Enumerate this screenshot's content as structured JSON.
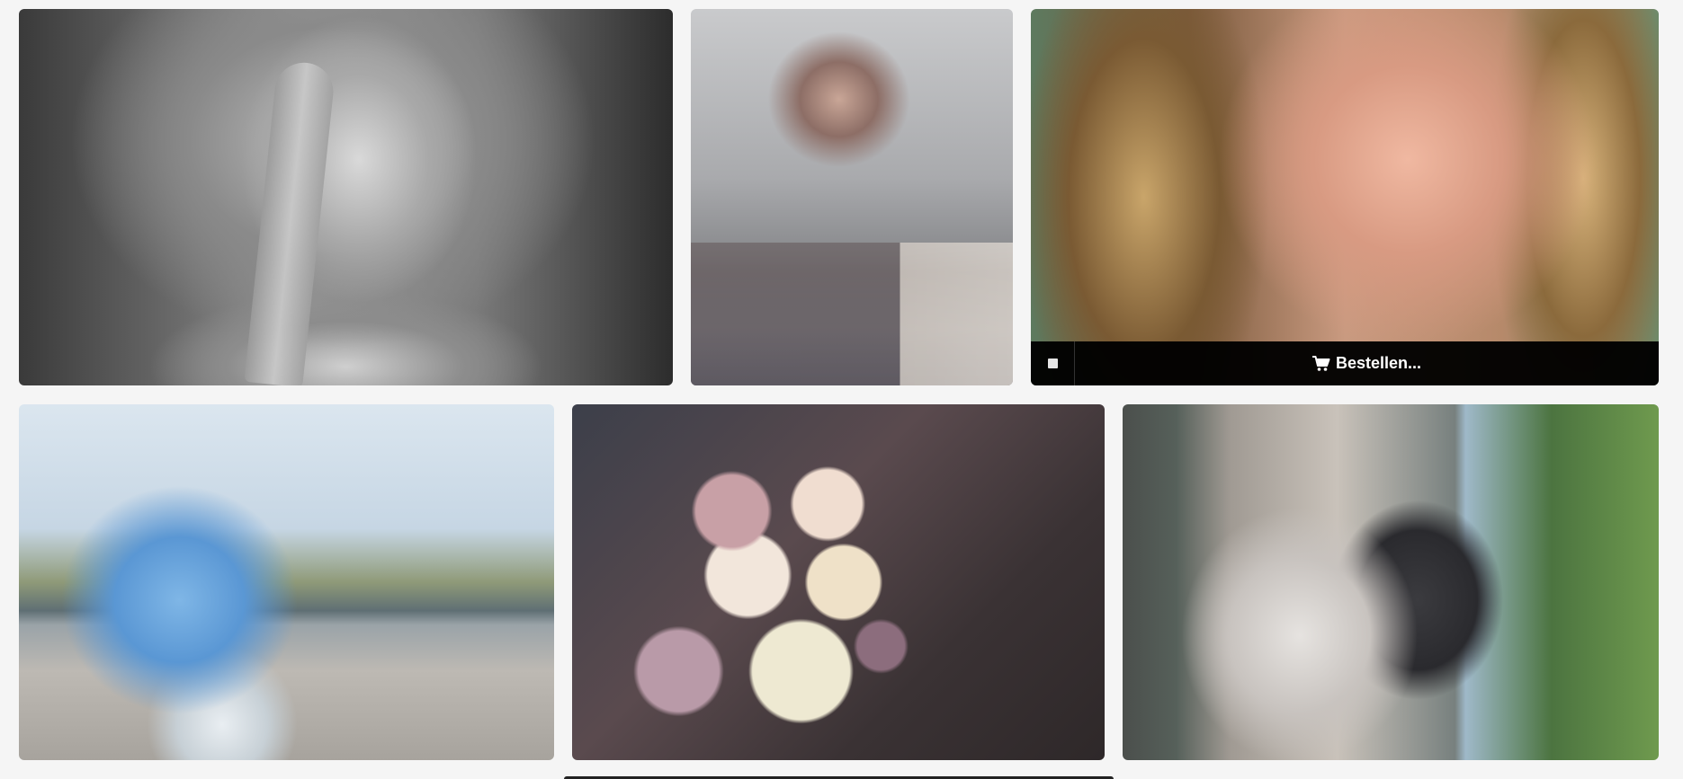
{
  "gallery": {
    "tiles": [
      {
        "id": "t1",
        "subject": "woman-finger-on-lips"
      },
      {
        "id": "t2",
        "subject": "woman-behind-rainy-window"
      },
      {
        "id": "t3",
        "subject": "woman-face-closeup",
        "overlay": {
          "select_icon": "square-icon",
          "order_icon": "cart-icon",
          "order_label": "Bestellen..."
        }
      },
      {
        "id": "t4",
        "subject": "woman-blue-knit-shawl-beach"
      },
      {
        "id": "t5",
        "subject": "flower-bouquet"
      },
      {
        "id": "t6",
        "subject": "bride-and-groom"
      },
      {
        "id": "t7",
        "subject": "next-row-photo"
      }
    ]
  },
  "colors": {
    "background": "#f5f5f5",
    "overlay_bar": "#000000",
    "overlay_text": "#ffffff"
  }
}
